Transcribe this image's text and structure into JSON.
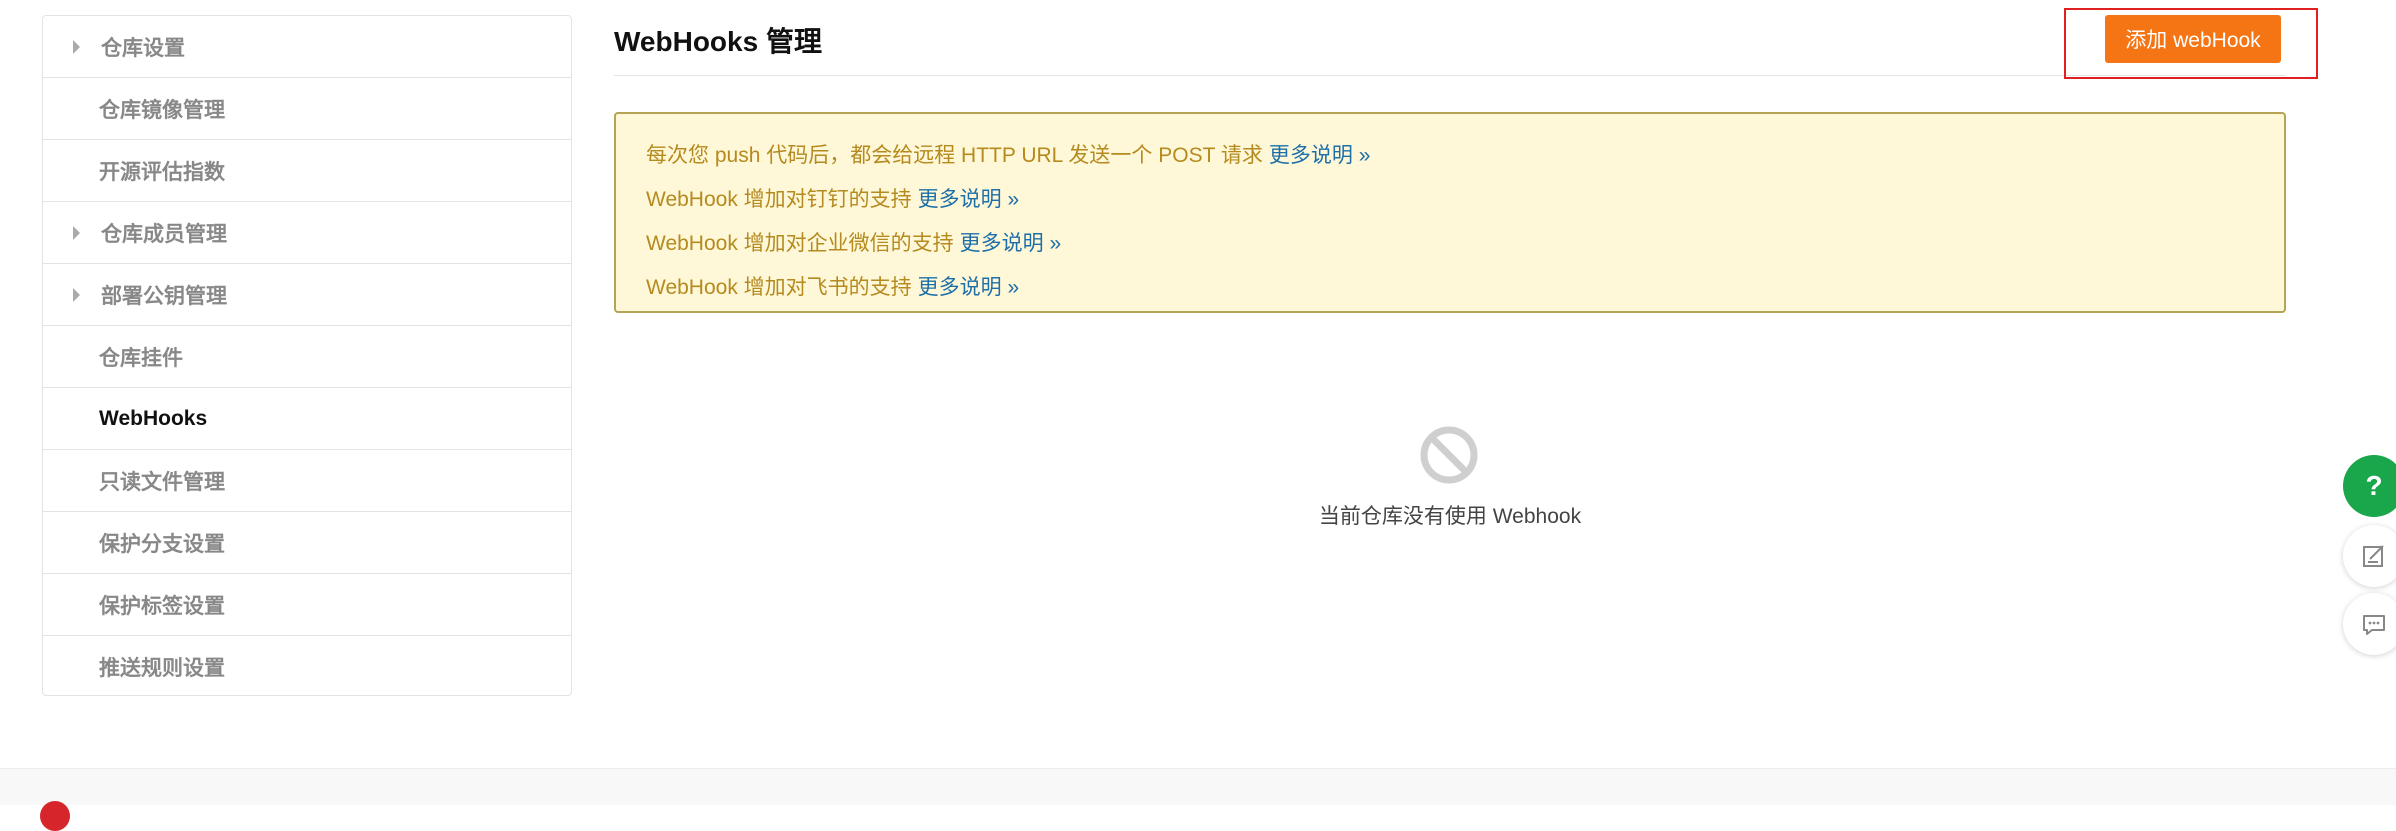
{
  "sidebar": {
    "items": [
      {
        "label": "仓库设置",
        "caret": true
      },
      {
        "label": "仓库镜像管理",
        "caret": false
      },
      {
        "label": "开源评估指数",
        "caret": false
      },
      {
        "label": "仓库成员管理",
        "caret": true
      },
      {
        "label": "部署公钥管理",
        "caret": true
      },
      {
        "label": "仓库挂件",
        "caret": false
      },
      {
        "label": "WebHooks",
        "caret": false,
        "active": true
      },
      {
        "label": "只读文件管理",
        "caret": false
      },
      {
        "label": "保护分支设置",
        "caret": false
      },
      {
        "label": "保护标签设置",
        "caret": false
      },
      {
        "label": "推送规则设置",
        "caret": false
      }
    ]
  },
  "header": {
    "title": "WebHooks 管理",
    "add_button_label": "添加 webHook"
  },
  "notice": {
    "lines": [
      {
        "text": "每次您 push 代码后，都会给远程 HTTP URL 发送一个 POST 请求",
        "link": "更多说明 »"
      },
      {
        "text": "WebHook 增加对钉钉的支持",
        "link": "更多说明 »"
      },
      {
        "text": "WebHook 增加对企业微信的支持",
        "link": "更多说明 »"
      },
      {
        "text": "WebHook 增加对飞书的支持",
        "link": "更多说明 »"
      }
    ]
  },
  "empty_state": {
    "icon": "no-entry-icon",
    "text": "当前仓库没有使用 Webhook"
  },
  "float_buttons": {
    "help_label": "?",
    "icons": [
      "help-icon",
      "edit-note-icon",
      "chat-icon"
    ]
  },
  "colors": {
    "accent_orange": "#f57414",
    "highlight_red": "#e02020",
    "notice_bg": "#fff8d8",
    "notice_text": "#b58a1e",
    "link_blue": "#1e6fa8",
    "help_green": "#1aa64a"
  }
}
